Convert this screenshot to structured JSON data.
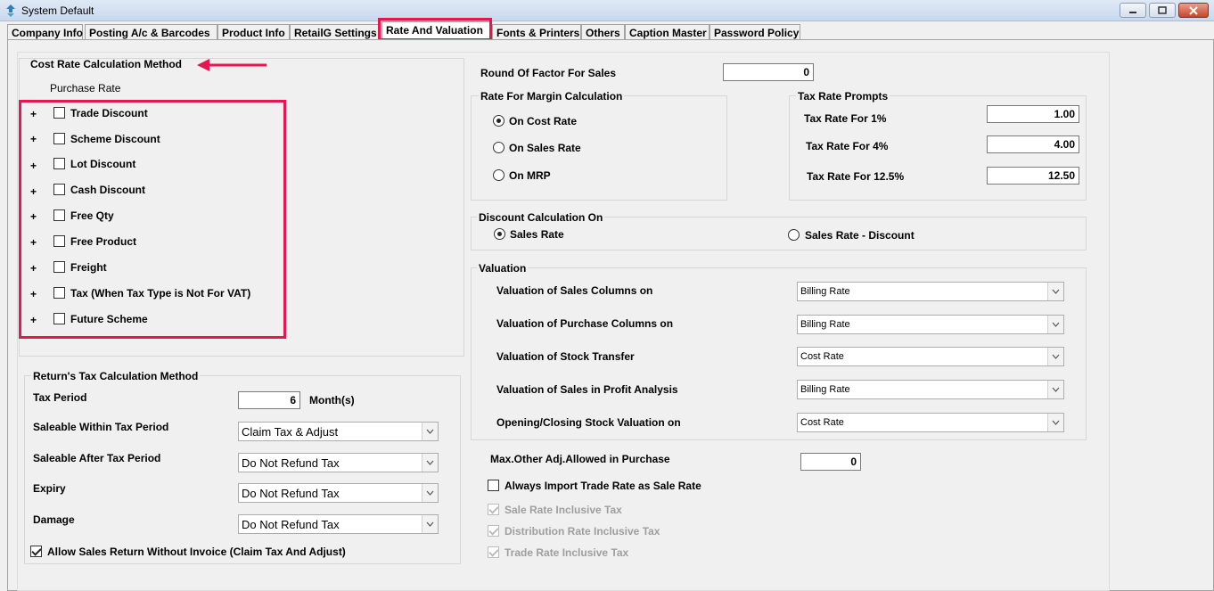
{
  "window": {
    "title": "System Default"
  },
  "tabs": [
    {
      "label": "Company Info"
    },
    {
      "label": "Posting A/c & Barcodes"
    },
    {
      "label": "Product Info"
    },
    {
      "label": "RetailG Settings"
    },
    {
      "label": "Rate And Valuation"
    },
    {
      "label": "Fonts & Printers"
    },
    {
      "label": "Others"
    },
    {
      "label": "Caption Master"
    },
    {
      "label": "Password Policy"
    }
  ],
  "active_tab": "Rate And Valuation",
  "colors": {
    "highlight": "#e6164f",
    "title_bar": "#dfe9f5"
  },
  "cost_rate": {
    "title": "Cost Rate Calculation Method",
    "subtitle": "Purchase Rate",
    "items": [
      {
        "sign": "+",
        "label": "Trade Discount",
        "checked": false
      },
      {
        "sign": "+",
        "label": "Scheme  Discount",
        "checked": false
      },
      {
        "sign": "+",
        "label": "Lot Discount",
        "checked": false
      },
      {
        "sign": "+",
        "label": "Cash Discount",
        "checked": false
      },
      {
        "sign": "+",
        "label": "Free Qty",
        "checked": false
      },
      {
        "sign": "+",
        "label": "Free Product",
        "checked": false
      },
      {
        "sign": "+",
        "label": "Freight",
        "checked": false
      },
      {
        "sign": "+",
        "label": "Tax (When Tax Type is Not For VAT)",
        "checked": false
      },
      {
        "sign": "+",
        "label": "Future Scheme",
        "checked": false
      }
    ]
  },
  "returns": {
    "title": "Return's Tax Calculation Method",
    "tax_period_label": "Tax Period",
    "tax_period_value": "6",
    "tax_period_unit": "Month(s)",
    "rows": [
      {
        "label": "Saleable  Within Tax Period",
        "value": "Claim Tax & Adjust"
      },
      {
        "label": "Saleable  After Tax Period",
        "value": "Do Not Refund Tax"
      },
      {
        "label": "Expiry",
        "value": "Do Not Refund Tax"
      },
      {
        "label": "Damage",
        "value": "Do Not Refund Tax"
      }
    ],
    "allow_return_label": "Allow Sales Return Without Invoice (Claim Tax And Adjust)",
    "allow_return_checked": true
  },
  "round_factor": {
    "label": "Round Of Factor For Sales",
    "value": "0"
  },
  "margin": {
    "title": "Rate For Margin Calculation",
    "options": [
      {
        "label": "On Cost Rate",
        "selected": true
      },
      {
        "label": "On Sales Rate",
        "selected": false
      },
      {
        "label": "On MRP",
        "selected": false
      }
    ]
  },
  "tax_prompts": {
    "title": "Tax Rate Prompts",
    "rows": [
      {
        "label": "Tax Rate For 1%",
        "value": "1.00"
      },
      {
        "label": "Tax Rate For 4%",
        "value": "4.00"
      },
      {
        "label": "Tax Rate For 12.5%",
        "value": "12.50"
      }
    ]
  },
  "discount": {
    "title": "Discount Calculation On",
    "options": [
      {
        "label": "Sales Rate",
        "selected": true
      },
      {
        "label": "Sales Rate - Discount",
        "selected": false
      }
    ]
  },
  "valuation": {
    "title": "Valuation",
    "rows": [
      {
        "label": "Valuation of Sales Columns on",
        "value": "Billing Rate"
      },
      {
        "label": "Valuation of Purchase Columns on",
        "value": "Billing Rate"
      },
      {
        "label": "Valuation of Stock Transfer",
        "value": "Cost Rate"
      },
      {
        "label": "Valuation of Sales in Profit Analysis",
        "value": "Billing Rate"
      },
      {
        "label": "Opening/Closing Stock Valuation on",
        "value": "Cost Rate"
      }
    ]
  },
  "max_adj": {
    "label": "Max.Other Adj.Allowed in Purchase",
    "value": "0"
  },
  "import_trade": {
    "label": "Always Import Trade Rate as Sale Rate",
    "checked": false
  },
  "inclusive": [
    {
      "label": "Sale Rate Inclusive Tax",
      "checked": true
    },
    {
      "label": "Distribution Rate Inclusive Tax",
      "checked": true
    },
    {
      "label": "Trade Rate Inclusive Tax",
      "checked": true
    }
  ]
}
